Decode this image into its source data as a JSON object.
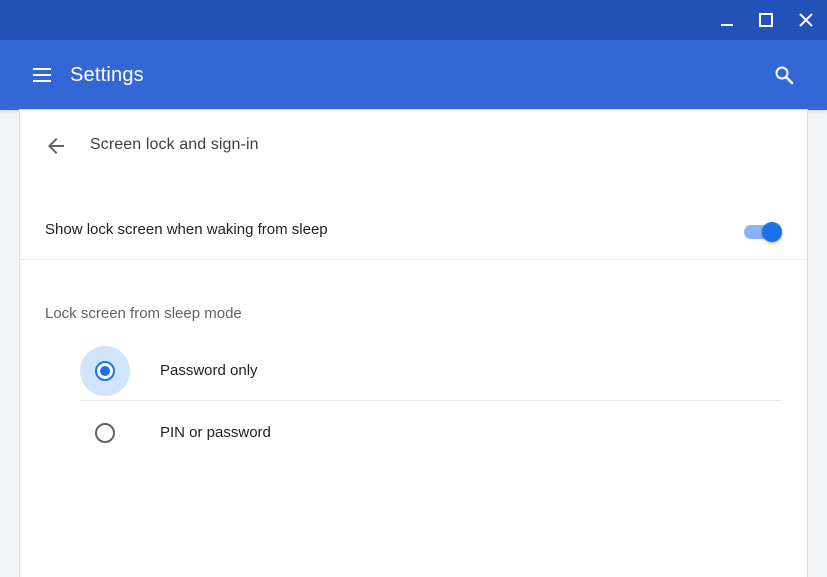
{
  "window": {
    "controls": {
      "minimize_icon": "minimize-icon",
      "maximize_icon": "maximize-icon",
      "close_icon": "close-icon"
    },
    "titlebar_color": "#2451b8"
  },
  "header": {
    "menu_icon": "hamburger-menu-icon",
    "title": "Settings",
    "search_icon": "search-icon",
    "color": "#3367d6"
  },
  "subpage": {
    "back_icon": "arrow-back-icon",
    "title": "Screen lock and sign-in"
  },
  "lock_on_wake": {
    "label": "Show lock screen when waking from sleep",
    "enabled": true
  },
  "lock_mode": {
    "section_label": "Lock screen from sleep mode",
    "options": [
      {
        "label": "Password only",
        "selected": true
      },
      {
        "label": "PIN or password",
        "selected": false
      }
    ]
  },
  "colors": {
    "accent": "#1a73e8",
    "toggle_track": "#8ab4f8",
    "ripple": "#d2e3fc"
  }
}
